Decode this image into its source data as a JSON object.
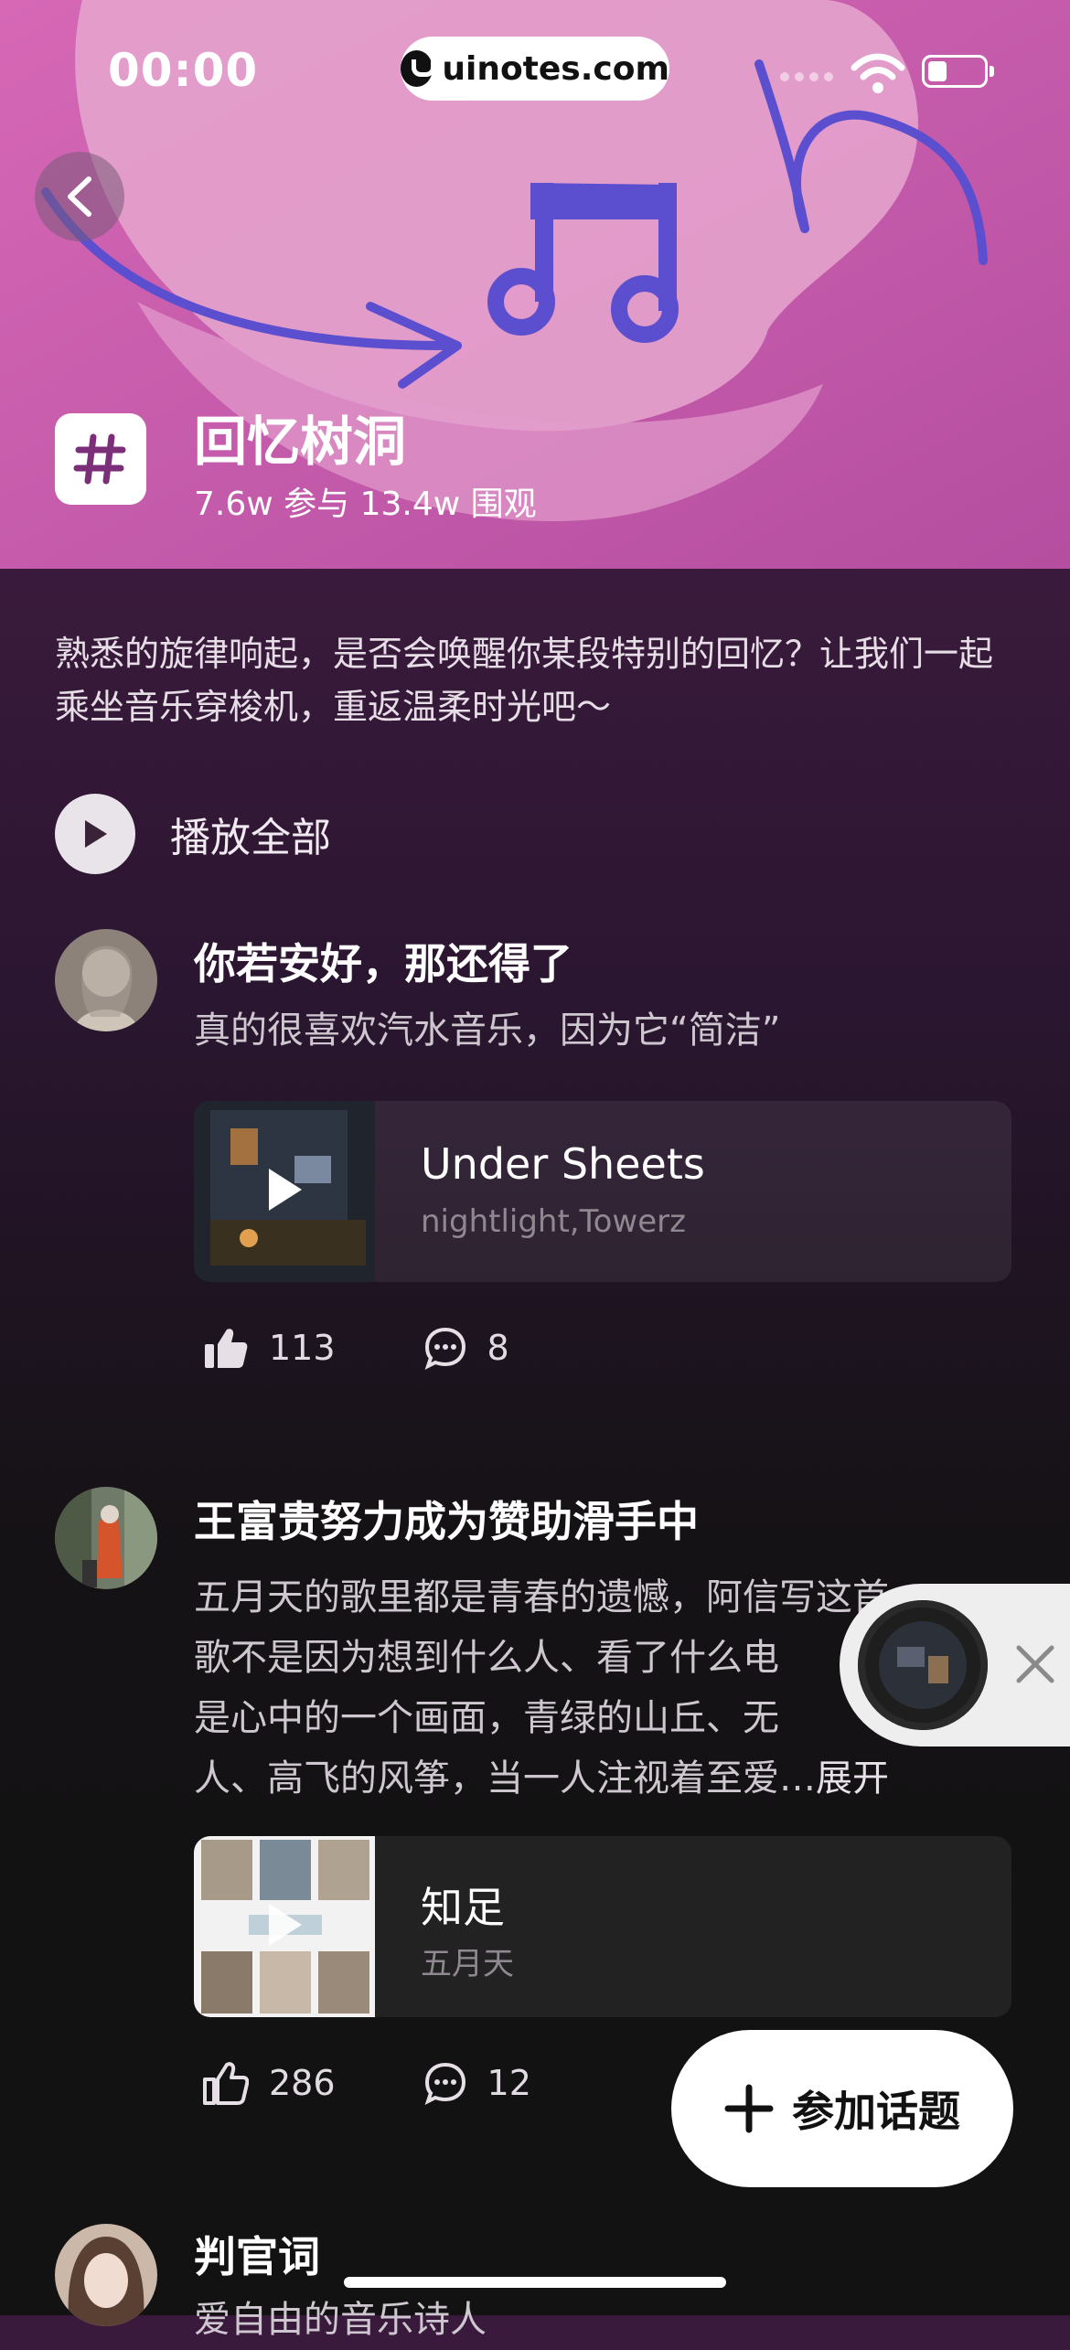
{
  "status_bar": {
    "time": "00:00",
    "watermark": "uinotes.com"
  },
  "topic": {
    "title": "回忆树洞",
    "stats": "7.6w 参与 13.4w 围观",
    "description": "熟悉的旋律响起，是否会唤醒你某段特别的回忆？让我们一起乘坐音乐穿梭机，重返温柔时光吧～",
    "play_all_label": "播放全部"
  },
  "posts": [
    {
      "username": "你若安好，那还得了",
      "text": "真的很喜欢汽水音乐，因为它“简洁”",
      "song": {
        "title": "Under Sheets",
        "artist": "nightlight,Towerz"
      },
      "likes": "113",
      "comments": "8"
    },
    {
      "username": "王富贵努力成为赞助滑手中",
      "text_lines": [
        "五月天的歌里都是青春的遗憾，阿信写这首",
        "歌不是因为想到什么人、看了什么电",
        "是心中的一个画面，青绿的山丘、无",
        "人、高飞的风筝，当一人注视着至爱…"
      ],
      "expand_label": "展开",
      "song": {
        "title": "知足",
        "artist": "五月天"
      },
      "likes": "286",
      "comments": "12"
    },
    {
      "username": "判官词",
      "text": "爱自由的音乐诗人"
    }
  ],
  "join_button": {
    "label": "参加话题"
  },
  "colors": {
    "hero_pink": "#c85fae",
    "accent_purple": "#5b4fd0"
  }
}
